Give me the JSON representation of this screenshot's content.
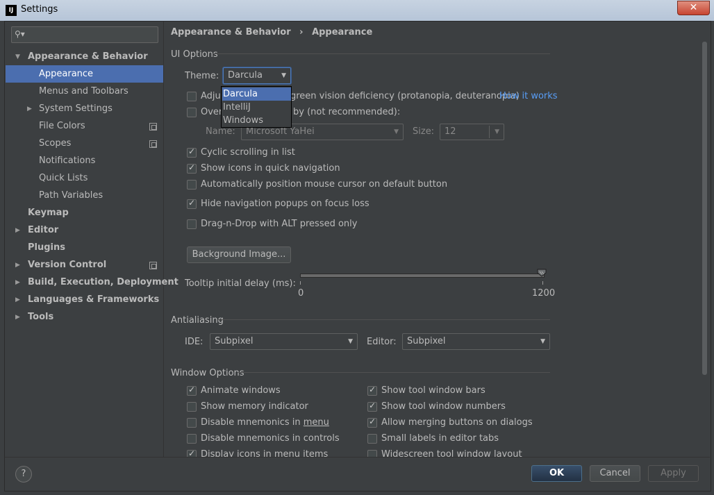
{
  "window": {
    "title": "Settings",
    "close": "✕"
  },
  "search": {
    "placeholder": ""
  },
  "sidebar": {
    "items": [
      {
        "label": "Appearance & Behavior"
      },
      {
        "label": "Appearance"
      },
      {
        "label": "Menus and Toolbars"
      },
      {
        "label": "System Settings"
      },
      {
        "label": "File Colors"
      },
      {
        "label": "Scopes"
      },
      {
        "label": "Notifications"
      },
      {
        "label": "Quick Lists"
      },
      {
        "label": "Path Variables"
      },
      {
        "label": "Keymap"
      },
      {
        "label": "Editor"
      },
      {
        "label": "Plugins"
      },
      {
        "label": "Version Control"
      },
      {
        "label": "Build, Execution, Deployment"
      },
      {
        "label": "Languages & Frameworks"
      },
      {
        "label": "Tools"
      }
    ]
  },
  "breadcrumb": {
    "parent": "Appearance & Behavior",
    "separator": "›",
    "current": "Appearance"
  },
  "ui_options": {
    "title": "UI Options",
    "theme_label": "Theme:",
    "theme_value": "Darcula",
    "theme_options": [
      "Darcula",
      "IntelliJ",
      "Windows"
    ],
    "adjust_prefix": "Adju",
    "adjust_label": "green vision deficiency (protanopia, deuteranopia)",
    "how_it_works": "How it works",
    "override_prefix": "Over",
    "override_label": "by (not recommended):",
    "name_label": "Name:",
    "font_name": "Microsoft YaHei",
    "size_label": "Size:",
    "font_size": "12",
    "cyclic_scrolling": "Cyclic scrolling in list",
    "show_icons_nav": "Show icons in quick navigation",
    "auto_position_cursor": "Automatically position mouse cursor on default button",
    "hide_nav_popups": "Hide navigation popups on focus loss",
    "drag_n_drop": "Drag-n-Drop with ALT pressed only",
    "background_image": "Background Image...",
    "tooltip_label": "Tooltip initial delay (ms):",
    "tooltip_min": "0",
    "tooltip_max": "1200",
    "tooltip_value": 1200
  },
  "antialiasing": {
    "title": "Antialiasing",
    "ide_label": "IDE:",
    "ide_value": "Subpixel",
    "editor_label": "Editor:",
    "editor_value": "Subpixel"
  },
  "window_options": {
    "title": "Window Options",
    "animate_windows": "Animate windows",
    "show_memory": "Show memory indicator",
    "disable_mnemonics_menu_prefix": "Disable mnemonics in ",
    "disable_mnemonics_menu_word": "menu",
    "disable_mnemonics_controls": "Disable mnemonics in controls",
    "display_icons_menu": "Display icons in menu items",
    "show_tool_window_bars": "Show tool window bars",
    "show_tool_window_numbers": "Show tool window numbers",
    "allow_merging_buttons": "Allow merging buttons on dialogs",
    "small_labels_editor_tabs": "Small labels in editor tabs",
    "widescreen_tool_window": "Widescreen tool window layout"
  },
  "footer": {
    "help": "?",
    "ok": "OK",
    "cancel": "Cancel",
    "apply": "Apply"
  }
}
